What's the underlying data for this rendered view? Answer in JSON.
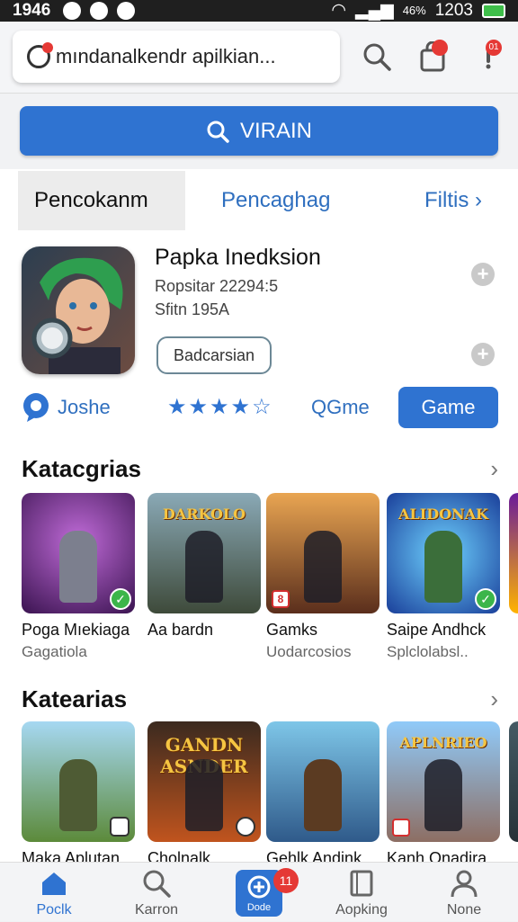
{
  "status_bar": {
    "time": "1946",
    "battery_pct": "46%",
    "clock": "1203"
  },
  "top_bar": {
    "search_text": "mındanalkendr apilkian...",
    "bag_badge": "",
    "alert_badge": "01"
  },
  "big_search": {
    "label": "VIRAIN"
  },
  "tabs": [
    {
      "label": "Pencokanm"
    },
    {
      "label": "Pencaghag"
    },
    {
      "label": "Filtis"
    }
  ],
  "featured": {
    "title": "Papka Inedksion",
    "line1": "Ropsitar 22294:5",
    "line2": "Sfitn 195A",
    "button": "Badcarsian"
  },
  "actions": {
    "joshe": "Joshe",
    "rating_stars": "★★★★☆",
    "qgme": "QGme",
    "game_button": "Game"
  },
  "colors": {
    "accent": "#2f73d1",
    "link": "#2f6fbf"
  },
  "section1": {
    "title": "Katacgrias",
    "items": [
      {
        "name": "Poga Mıekiaga",
        "sub": "Gagatiola",
        "thumb_title": ""
      },
      {
        "name": "Aa bardn",
        "sub": "",
        "thumb_title": "DARKOLO"
      },
      {
        "name": "Gamks",
        "sub": "Uodarcosios",
        "thumb_title": ""
      },
      {
        "name": "Saipe Andhck",
        "sub": "Splclolabsl..",
        "thumb_title": "ALIDONAK"
      }
    ]
  },
  "section2": {
    "title": "Katearias",
    "items": [
      {
        "name": "Maka Aplutan",
        "thumb_title": ""
      },
      {
        "name": "Cholnalk",
        "thumb_title": "GANDN ASNDER"
      },
      {
        "name": "Gehlk Andink",
        "thumb_title": ""
      },
      {
        "name": "Kanh Onadira",
        "thumb_title": "APLNRIEO"
      }
    ]
  },
  "bottom_nav": {
    "items": [
      {
        "label": "Poclk"
      },
      {
        "label": "Karron"
      },
      {
        "label": "Dode"
      },
      {
        "label": "Aopking"
      },
      {
        "label": "None"
      }
    ],
    "center_badge": "11"
  }
}
